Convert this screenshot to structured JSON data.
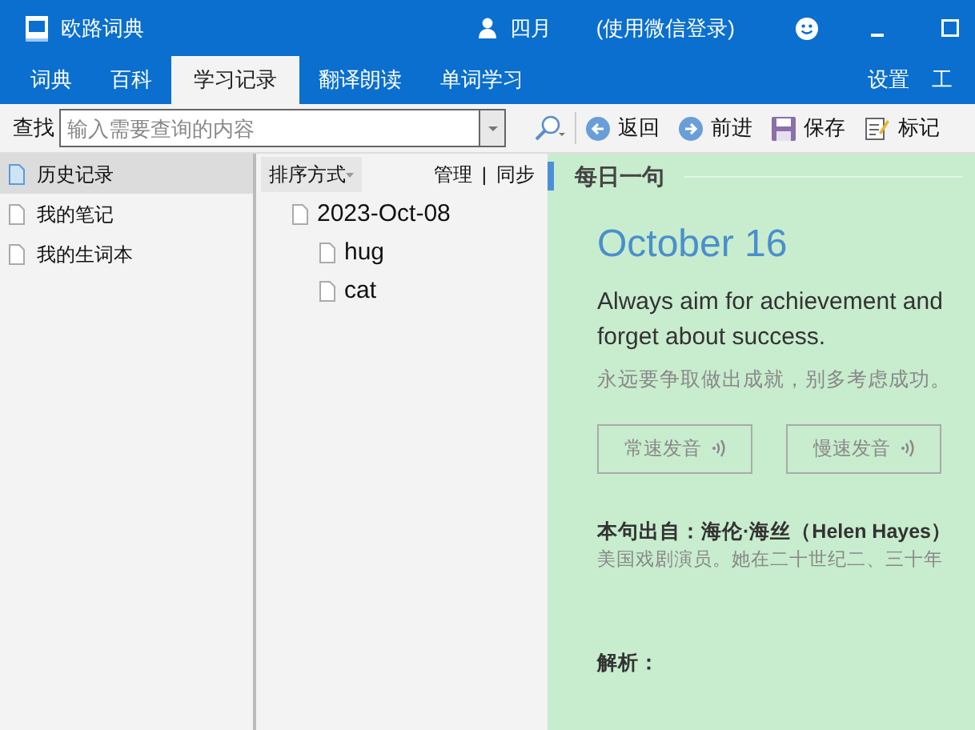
{
  "window": {
    "title": "欧路词典",
    "user": "四月",
    "login_hint": "(使用微信登录)"
  },
  "tabs": [
    {
      "label": "词典",
      "selected": false
    },
    {
      "label": "百科",
      "selected": false
    },
    {
      "label": "学习记录",
      "selected": true
    },
    {
      "label": "翻译朗读",
      "selected": false
    },
    {
      "label": "单词学习",
      "selected": false
    }
  ],
  "right_tabs": [
    "设置",
    "工"
  ],
  "toolbar": {
    "search_label": "查找",
    "search": {
      "placeholder": "输入需要查询的内容"
    },
    "buttons": [
      {
        "kind": "back",
        "label": "返回"
      },
      {
        "kind": "forward",
        "label": "前进"
      },
      {
        "kind": "save",
        "label": "保存"
      },
      {
        "kind": "mark",
        "label": "标记"
      }
    ]
  },
  "sidebar": {
    "items": [
      {
        "label": "历史记录",
        "selected": true
      },
      {
        "label": "我的笔记",
        "selected": false
      },
      {
        "label": "我的生词本",
        "selected": false
      }
    ]
  },
  "history": {
    "sort_label": "排序方式",
    "manage": "管理",
    "separator": "|",
    "sync": "同步",
    "tree": [
      {
        "label": "2023-Oct-08",
        "children": [
          {
            "label": "hug"
          },
          {
            "label": "cat"
          }
        ]
      }
    ]
  },
  "daily": {
    "heading": "每日一句",
    "date": "October 16",
    "sentence": "Always aim for achievement and forget about success.",
    "translation": "永远要争取做出成就，别多考虑成功。",
    "buttons": [
      "常速发音",
      "慢速发音"
    ],
    "source_label": "本句出自：海伦·海丝（Helen Hayes）",
    "source_bio": "美国戏剧演员。她在二十世纪二、三十年",
    "analysis_label": "解析："
  }
}
